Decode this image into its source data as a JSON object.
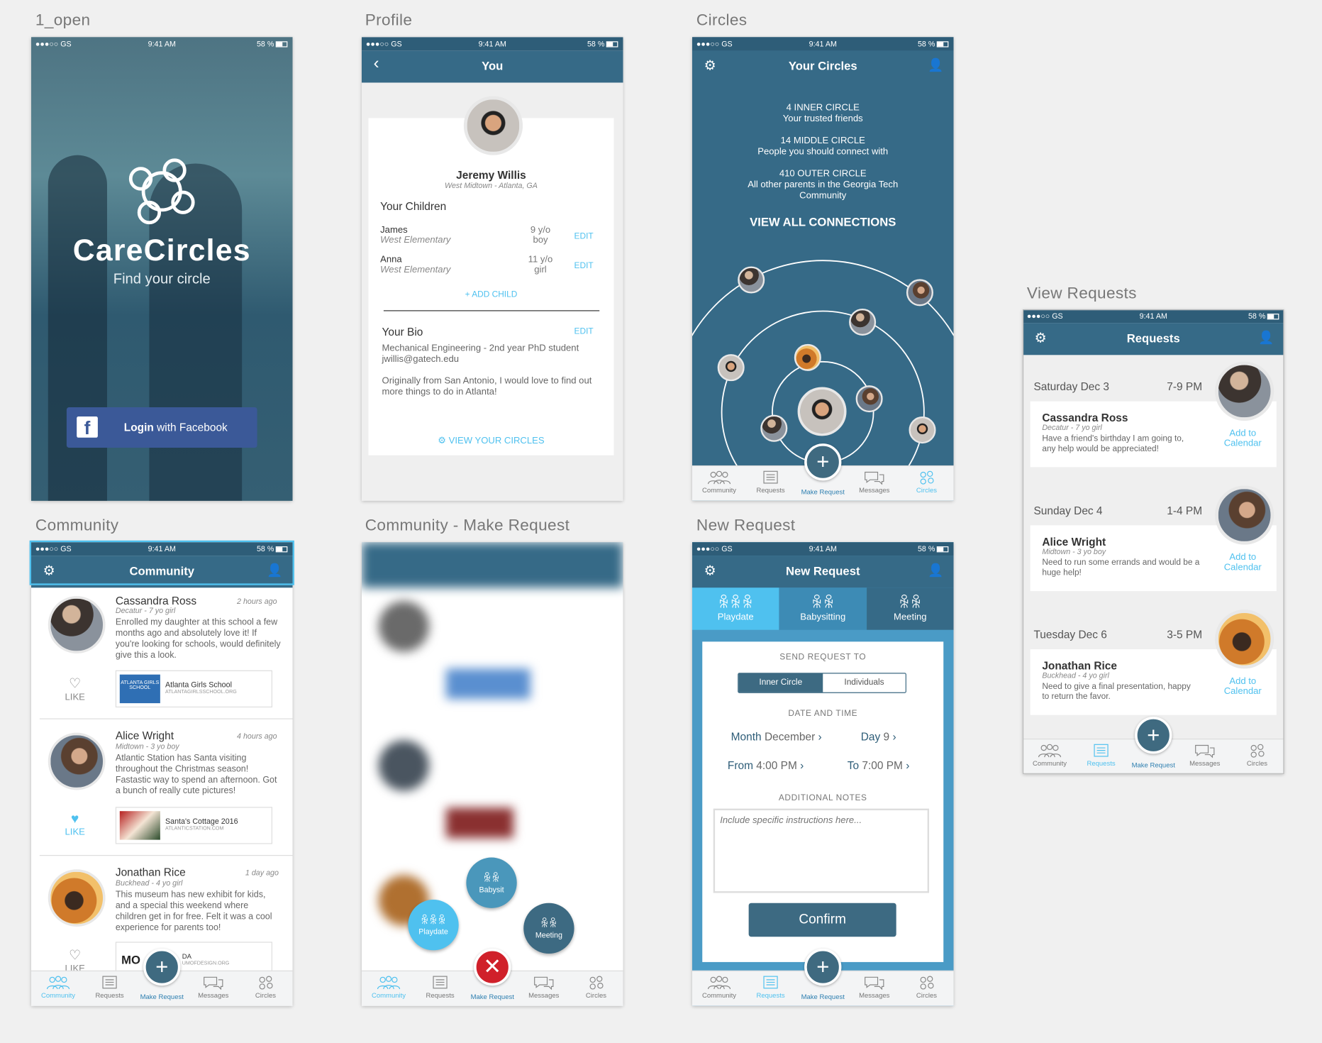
{
  "status": {
    "carrier": "●●●○○ GS",
    "time": "9:41 AM",
    "battery": "58 %"
  },
  "labels": {
    "open": "1_open",
    "profile": "Profile",
    "circles": "Circles",
    "requests": "View Requests",
    "community": "Community",
    "make": "Community - Make Request",
    "newreq": "New Request"
  },
  "tabbar": {
    "community": "Community",
    "requests": "Requests",
    "make": "Make Request",
    "messages": "Messages",
    "circles": "Circles"
  },
  "open": {
    "title": "CareCircles",
    "subtitle": "Find your circle",
    "login_a": "Login",
    "login_b": " with Facebook"
  },
  "profile": {
    "nav": "You",
    "name": "Jeremy Willis",
    "location": "West Midtown - Atlanta, GA",
    "children_h": "Your Children",
    "children": [
      {
        "name": "James",
        "school": "West Elementary",
        "age": "9 y/o",
        "sex": "boy",
        "edit": "EDIT"
      },
      {
        "name": "Anna",
        "school": "West Elementary",
        "age": "11 y/o",
        "sex": "girl",
        "edit": "EDIT"
      }
    ],
    "add_child": "+ ADD CHILD",
    "bio_h": "Your Bio",
    "bio_edit": "EDIT",
    "bio1": "Mechanical Engineering - 2nd year PhD student",
    "bio2": "jwillis@gatech.edu",
    "bio3": "Originally from San Antonio, I would love to find out more things to do in Atlanta!",
    "view": "VIEW YOUR CIRCLES"
  },
  "circles": {
    "nav": "Your Circles",
    "inner_a": "4 INNER CIRCLE",
    "inner_b": "Your trusted friends",
    "middle_a": "14 MIDDLE CIRCLE",
    "middle_b": "People you should connect with",
    "outer_a": "410 OUTER CIRCLE",
    "outer_b": "All other parents in the Georgia Tech Community",
    "all": "VIEW ALL CONNECTIONS"
  },
  "requests": {
    "nav": "Requests",
    "items": [
      {
        "date": "Saturday Dec 3",
        "time": "7-9 PM",
        "name": "Cassandra Ross",
        "meta": "Decatur - 7 yo girl",
        "text": "Have a friend's birthday I am going to, any help would be appreciated!",
        "cal": "Add to Calendar"
      },
      {
        "date": "Sunday Dec 4",
        "time": "1-4 PM",
        "name": "Alice Wright",
        "meta": "Midtown - 3 yo boy",
        "text": "Need to run some errands and would be a huge help!",
        "cal": "Add to Calendar"
      },
      {
        "date": "Tuesday Dec 6",
        "time": "3-5 PM",
        "name": "Jonathan Rice",
        "meta": "Buckhead - 4 yo girl",
        "text": "Need to give a final presentation, happy to return the favor.",
        "cal": "Add to Calendar"
      }
    ]
  },
  "community": {
    "nav": "Community",
    "like": "LIKE",
    "posts": [
      {
        "name": "Cassandra Ross",
        "meta": "Decatur - 7 yo girl",
        "time": "2 hours ago",
        "text": "Enrolled my daughter at this school a few months ago and absolutely love it! If you're looking for schools, would definitely give this a look.",
        "link_t": "Atlanta Girls School",
        "link_u": "ATLANTAGIRLSSCHOOL.ORG",
        "thumb": "ATLANTA GIRLS SCHOOL"
      },
      {
        "name": "Alice Wright",
        "meta": "Midtown - 3 yo boy",
        "time": "4 hours ago",
        "text": "Atlantic Station has Santa visiting throughout the Christmas season! Fastastic way to spend an afternoon. Got a bunch of really cute pictures!",
        "link_t": "Santa's Cottage 2016",
        "link_u": "ATLANTICSTATION.COM"
      },
      {
        "name": "Jonathan Rice",
        "meta": "Buckhead - 4 yo girl",
        "time": "1 day ago",
        "text": "This museum has new exhibit for kids, and a special this weekend where children get in for free. Felt it was a cool experience for parents too!",
        "link_t": "MO",
        "link_u": "UMOFDESIGN.ORG",
        "link_x": "DA"
      }
    ]
  },
  "make": {
    "babysit": "Babysit",
    "playdate": "Playdate",
    "meeting": "Meeting"
  },
  "newreq": {
    "nav": "New Request",
    "tabs": [
      "Playdate",
      "Babysitting",
      "Meeting"
    ],
    "send_h": "SEND REQUEST TO",
    "seg": [
      "Inner Circle",
      "Individuals"
    ],
    "dt_h": "DATE AND TIME",
    "month_l": "Month",
    "month_v": "December",
    "day_l": "Day",
    "day_v": "9",
    "from_l": "From",
    "from_v": "4:00 PM",
    "to_l": "To",
    "to_v": "7:00 PM",
    "notes_h": "ADDITIONAL NOTES",
    "notes_ph": "Include specific instructions here...",
    "confirm": "Confirm"
  }
}
